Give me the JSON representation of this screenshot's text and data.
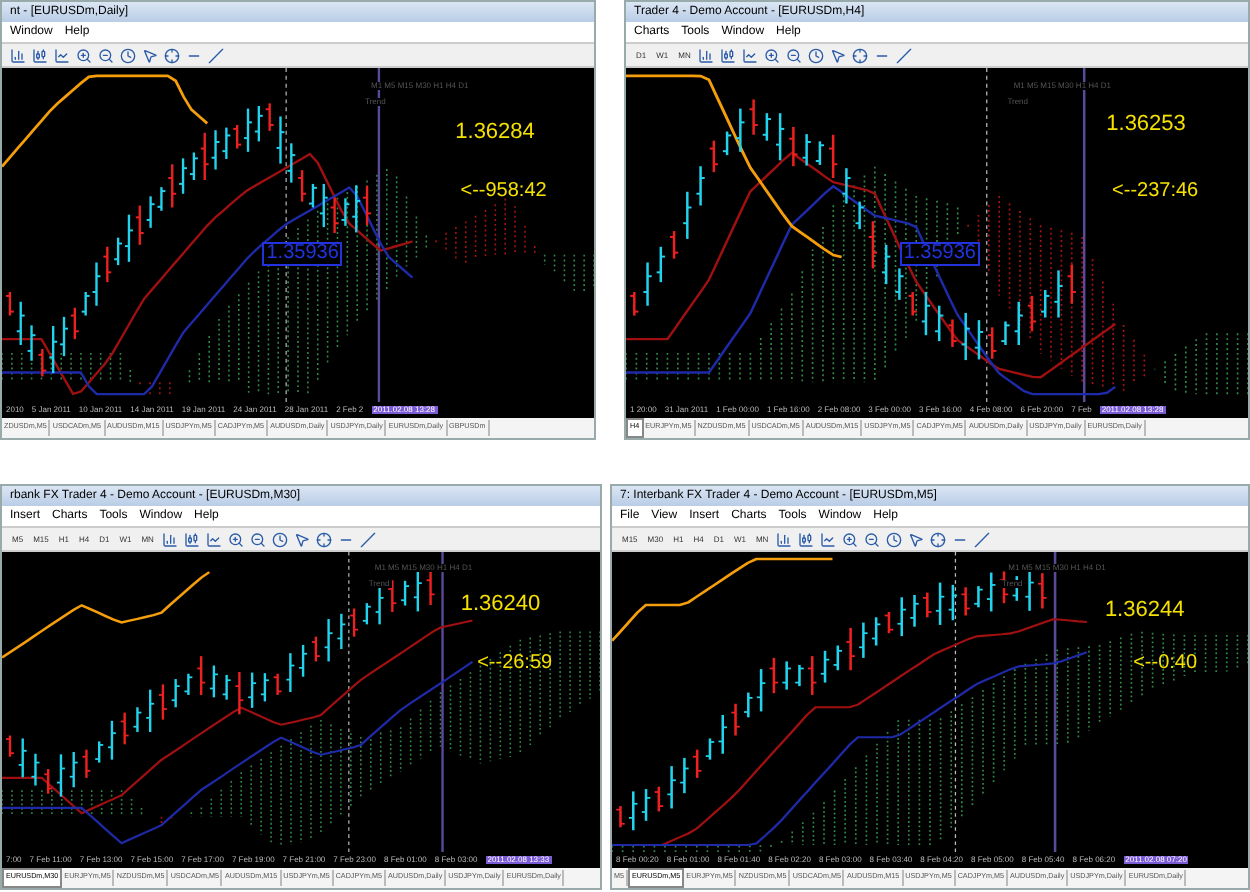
{
  "windows": [
    {
      "title": "nt - [EURUSDm,Daily]",
      "menu": [
        "Window",
        "Help"
      ],
      "chart": {
        "price": "1.36284",
        "countdown": "<--958:42",
        "marker_price": "1.35936",
        "timeframe_row": "M1 M5 M15 M30 H1 H4 D1",
        "trend_label": "Trend",
        "axis_labels": [
          "2010",
          "5 Jan 2011",
          "10 Jan 2011",
          "14 Jan 2011",
          "19 Jan 2011",
          "24 Jan 2011",
          "28 Jan 2011",
          "2 Feb 2"
        ],
        "highlighted_time": "2011.02.08 13:28"
      },
      "tabs": [
        {
          "label": "ZDUSDm,M5",
          "selected": false
        },
        {
          "label": "USDCADm,M5",
          "selected": false
        },
        {
          "label": "AUDUSDm,M15",
          "selected": false
        },
        {
          "label": "USDJPYm,M5",
          "selected": false
        },
        {
          "label": "CADJPYm,M5",
          "selected": false
        },
        {
          "label": "AUDUSDm,Daily",
          "selected": false
        },
        {
          "label": "USDJPYm,Daily",
          "selected": false
        },
        {
          "label": "EURUSDm,Daily",
          "selected": false
        },
        {
          "label": "GBPUSDm",
          "selected": false
        }
      ]
    },
    {
      "title": "Trader 4 - Demo Account - [EURUSDm,H4]",
      "menu": [
        "Charts",
        "Tools",
        "Window",
        "Help"
      ],
      "timeframes": [
        "D1",
        "W1",
        "MN"
      ],
      "chart": {
        "price": "1.36253",
        "countdown": "<--237:46",
        "marker_price": "1.35936",
        "timeframe_row": "M1 M5 M15 M30 H1 H4 D1",
        "trend_label": "Trend",
        "axis_labels": [
          "1 20:00",
          "31 Jan 2011",
          "1 Feb 00:00",
          "1 Feb 16:00",
          "2 Feb 08:00",
          "3 Feb 00:00",
          "3 Feb 16:00",
          "4 Feb 08:00",
          "6 Feb 20:00",
          "7 Feb"
        ],
        "highlighted_time": "2011.02.08 13:28"
      },
      "tabs": [
        {
          "label": "H4",
          "selected": true
        },
        {
          "label": "EURJPYm,M5",
          "selected": false
        },
        {
          "label": "NZDUSDm,M5",
          "selected": false
        },
        {
          "label": "USDCADm,M5",
          "selected": false
        },
        {
          "label": "AUDUSDm,M15",
          "selected": false
        },
        {
          "label": "USDJPYm,M5",
          "selected": false
        },
        {
          "label": "CADJPYm,M5",
          "selected": false
        },
        {
          "label": "AUDUSDm,Daily",
          "selected": false
        },
        {
          "label": "USDJPYm,Daily",
          "selected": false
        },
        {
          "label": "EURUSDm,Daily",
          "selected": false
        }
      ]
    },
    {
      "title": "rbank FX Trader 4 - Demo Account - [EURUSDm,M30]",
      "menu": [
        "Insert",
        "Charts",
        "Tools",
        "Window",
        "Help"
      ],
      "timeframes": [
        "M5",
        "M15",
        "H1",
        "H4",
        "D1",
        "W1",
        "MN"
      ],
      "chart": {
        "price": "1.36240",
        "countdown": "<--26:59",
        "timeframe_row": "M1 M5 M15 M30 H1 H4 D1",
        "trend_label": "Trend",
        "axis_labels": [
          "7:00",
          "7 Feb 11:00",
          "7 Feb 13:00",
          "7 Feb 15:00",
          "7 Feb 17:00",
          "7 Feb 19:00",
          "7 Feb 21:00",
          "7 Feb 23:00",
          "8 Feb 01:00",
          "8 Feb 03:00"
        ],
        "highlighted_time": "2011.02.08 13:33"
      },
      "tabs": [
        {
          "label": "EURUSDm,M30",
          "selected": true
        },
        {
          "label": "EURJPYm,M5",
          "selected": false
        },
        {
          "label": "NZDUSDm,M5",
          "selected": false
        },
        {
          "label": "USDCADm,M5",
          "selected": false
        },
        {
          "label": "AUDUSDm,M15",
          "selected": false
        },
        {
          "label": "USDJPYm,M5",
          "selected": false
        },
        {
          "label": "CADJPYm,M5",
          "selected": false
        },
        {
          "label": "AUDUSDm,Daily",
          "selected": false
        },
        {
          "label": "USDJPYm,Daily",
          "selected": false
        },
        {
          "label": "EURUSDm,Daily",
          "selected": false
        }
      ]
    },
    {
      "title": "7: Interbank FX Trader 4 - Demo Account - [EURUSDm,M5]",
      "menu": [
        "File",
        "View",
        "Insert",
        "Charts",
        "Tools",
        "Window",
        "Help"
      ],
      "timeframes": [
        "M15",
        "M30",
        "H1",
        "H4",
        "D1",
        "W1",
        "MN"
      ],
      "chart": {
        "price": "1.36244",
        "countdown": "<--0:40",
        "timeframe_row": "M1 M5 M15 M30 H1 H4 D1",
        "trend_label": "Trend",
        "axis_labels": [
          "8 Feb 00:20",
          "8 Feb 01:00",
          "8 Feb 01:40",
          "8 Feb 02:20",
          "8 Feb 03:00",
          "8 Feb 03:40",
          "8 Feb 04:20",
          "8 Feb 05:00",
          "8 Feb 05:40",
          "8 Feb 06:20"
        ],
        "highlighted_time": "2011.02.08 07:20"
      },
      "tabs": [
        {
          "label": "M5",
          "selected": false
        },
        {
          "label": "EURUSDm,M5",
          "selected": true
        },
        {
          "label": "EURJPYm,M5",
          "selected": false
        },
        {
          "label": "NZDUSDm,M5",
          "selected": false
        },
        {
          "label": "USDCADm,M5",
          "selected": false
        },
        {
          "label": "AUDUSDm,M15",
          "selected": false
        },
        {
          "label": "USDJPYm,M5",
          "selected": false
        },
        {
          "label": "CADJPYm,M5",
          "selected": false
        },
        {
          "label": "AUDUSDm,Daily",
          "selected": false
        },
        {
          "label": "USDJPYm,Daily",
          "selected": false
        },
        {
          "label": "EURUSDm,Daily",
          "selected": false
        }
      ]
    }
  ]
}
